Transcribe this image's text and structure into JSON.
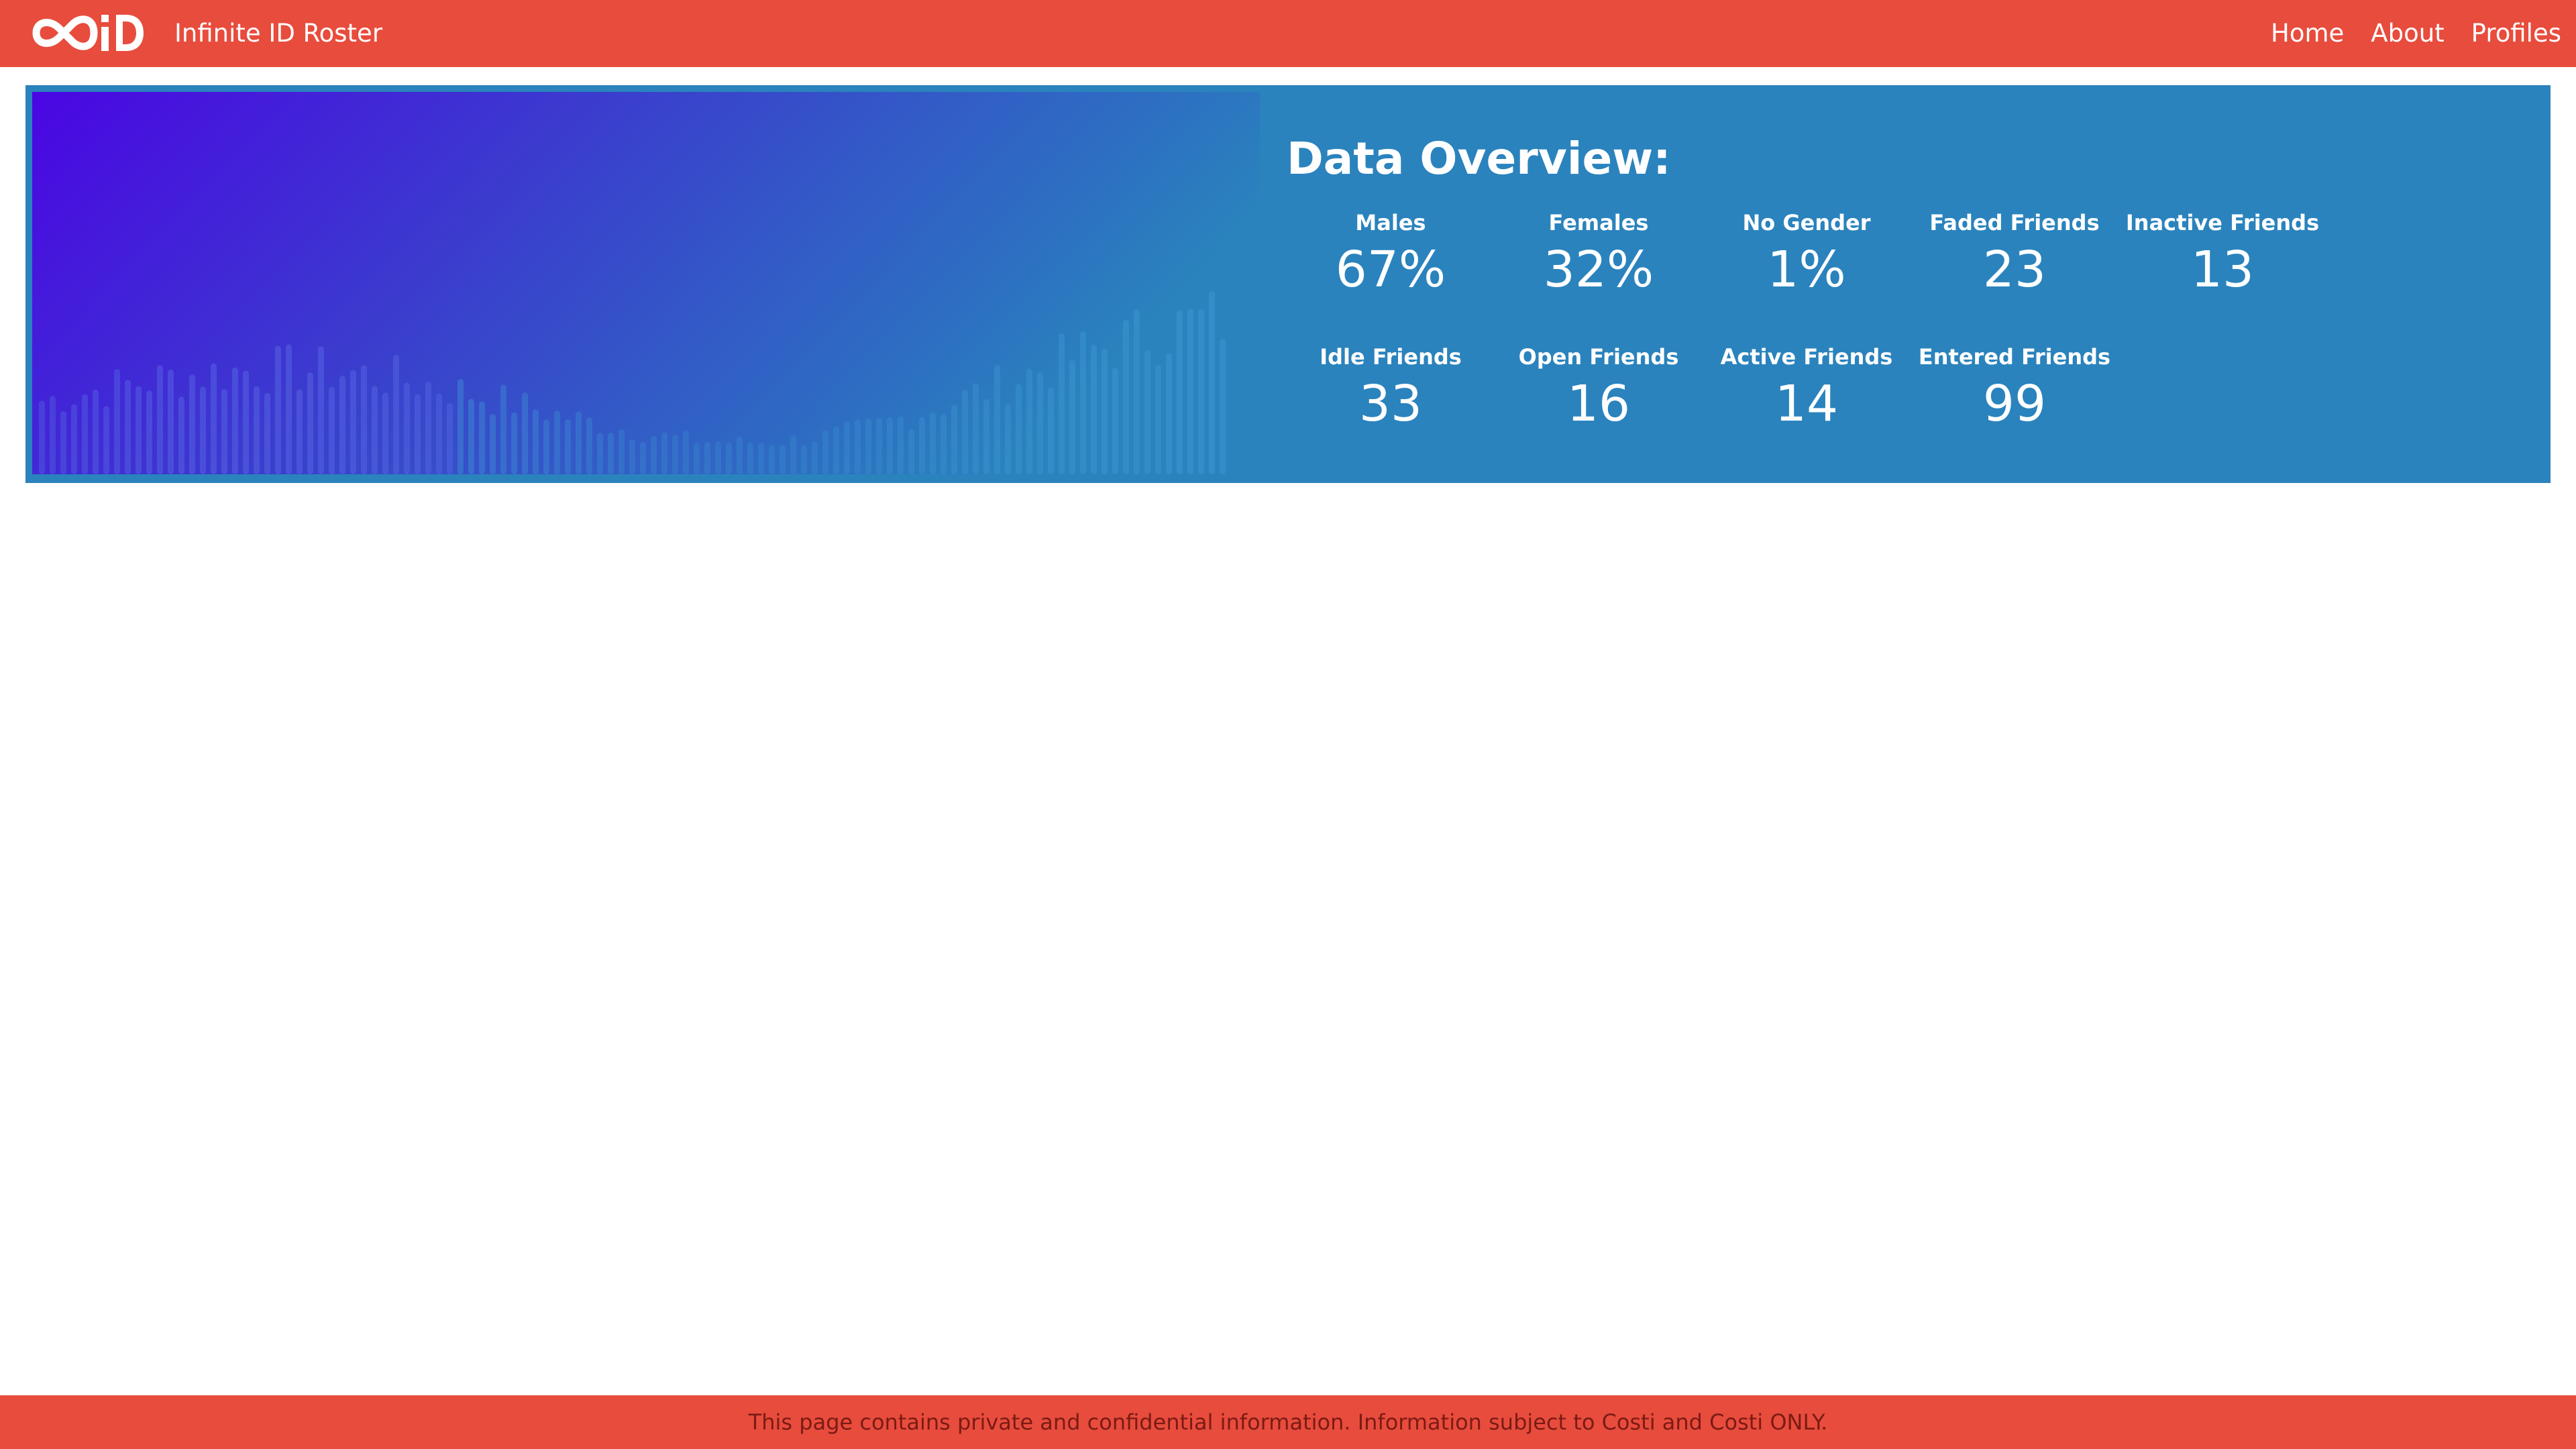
{
  "navbar": {
    "logo_text": "∞iD",
    "title": "Infinite ID Roster",
    "links": [
      "Home",
      "About",
      "Profiles"
    ]
  },
  "overview": {
    "title": "Data Overview:",
    "stats": [
      {
        "label": "Males",
        "value": "67%"
      },
      {
        "label": "Females",
        "value": "32%"
      },
      {
        "label": "No Gender",
        "value": "1%"
      },
      {
        "label": "Faded Friends",
        "value": "23"
      },
      {
        "label": "Inactive Friends",
        "value": "13"
      },
      {
        "label": "Idle Friends",
        "value": "33"
      },
      {
        "label": "Open Friends",
        "value": "16"
      },
      {
        "label": "Active Friends",
        "value": "14"
      },
      {
        "label": "Entered Friends",
        "value": "99"
      }
    ]
  },
  "footer": {
    "text": "This page contains private and confidential information. Information subject to Costi and Costi ONLY."
  },
  "colors": {
    "accent": "#e84c3d",
    "panel": "#2a83bd",
    "banner_start": "#4a06e3",
    "banner_end": "#2a83bd"
  }
}
